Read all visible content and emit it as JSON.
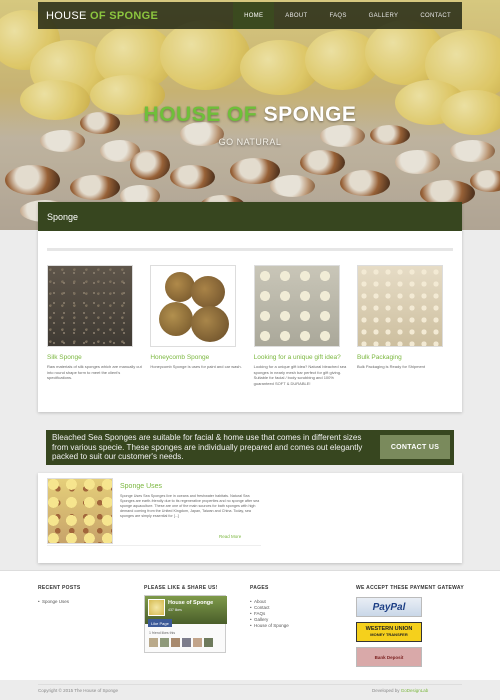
{
  "navbar": {
    "logo_part1": "HOUSE",
    "logo_part2": " OF SPONGE",
    "items": [
      {
        "label": "HOME",
        "active": true
      },
      {
        "label": "ABOUT",
        "active": false
      },
      {
        "label": "FAQS",
        "active": false
      },
      {
        "label": "GALLERY",
        "active": false
      },
      {
        "label": "CONTACT",
        "active": false
      }
    ]
  },
  "hero": {
    "title_part1": "HOUSE OF",
    "title_part2": " SPONGE",
    "subtitle": "GO NATURAL"
  },
  "sponge_section": {
    "heading": "Sponge",
    "products": [
      {
        "title": "Silk Sponge",
        "desc": "Raw materials of silk sponges which are manually cut into round shape form to meet the client's specifications."
      },
      {
        "title": "Honeycomb Sponge",
        "desc": "Honeycomb Sponge is uses for paint and car wash."
      },
      {
        "title": "Looking for a unique gift idea?",
        "desc": "Looking for a unique gift idea? Natural bleached sea sponges in nearly mesh bar perfect for gift giving. Suitable for facial / body scrubbing and 100% guaranteed SOFT & DURABLE!"
      },
      {
        "title": "Bulk Packaging",
        "desc": "Bulk Packaging is Ready for Shipment"
      }
    ]
  },
  "cta": {
    "text": "Bleached Sea Sponges are suitable for facial & home use that comes in different sizes from various specie. These sponges are individually prepared and comes out elegantly packed to suit our customer's needs.",
    "button": "CONTACT US"
  },
  "uses": {
    "title": "Sponge Uses",
    "desc": "Sponge Uses Sea Sponges live in oceans and freshwater habitats. Natural Sea Sponges are earth-friendly due to its regenerative properties and no sponge after sea sponge aquaculture. These are one of the main sources for bath sponges with high demand coming from the United Kingdom, Japan, Taiwan and China. Today, sea sponges are simply essential for [...]",
    "more": "Read More"
  },
  "footer": {
    "recent_posts": {
      "heading": "RECENT POSTS",
      "items": [
        "Sponge Uses"
      ]
    },
    "share": {
      "heading": "PLEASE LIKE & SHARE US!",
      "page_name": "House of Sponge",
      "likes": "437 likes",
      "like_button": "Like Page",
      "friends": "1 friend likes this"
    },
    "pages": {
      "heading": "PAGES",
      "items": [
        "About",
        "Contact",
        "FAQs",
        "Gallery",
        "House of Sponge"
      ]
    },
    "payment": {
      "heading": "WE ACCEPT THESE PAYMENT GATEWAY",
      "paypal": "PayPal",
      "western_union": "WESTERN UNION",
      "western_union_sub": "MONEY TRANSFER",
      "bank": "Bank Deposit"
    },
    "copyright": "Copyright © 2015 The House of Sponge",
    "developed_by": "Developed by",
    "developer": " GoDesignLab"
  },
  "colors": {
    "accent_green": "#7bb73f",
    "dark_olive": "#37461f",
    "cta_button": "#7a8a5c"
  }
}
